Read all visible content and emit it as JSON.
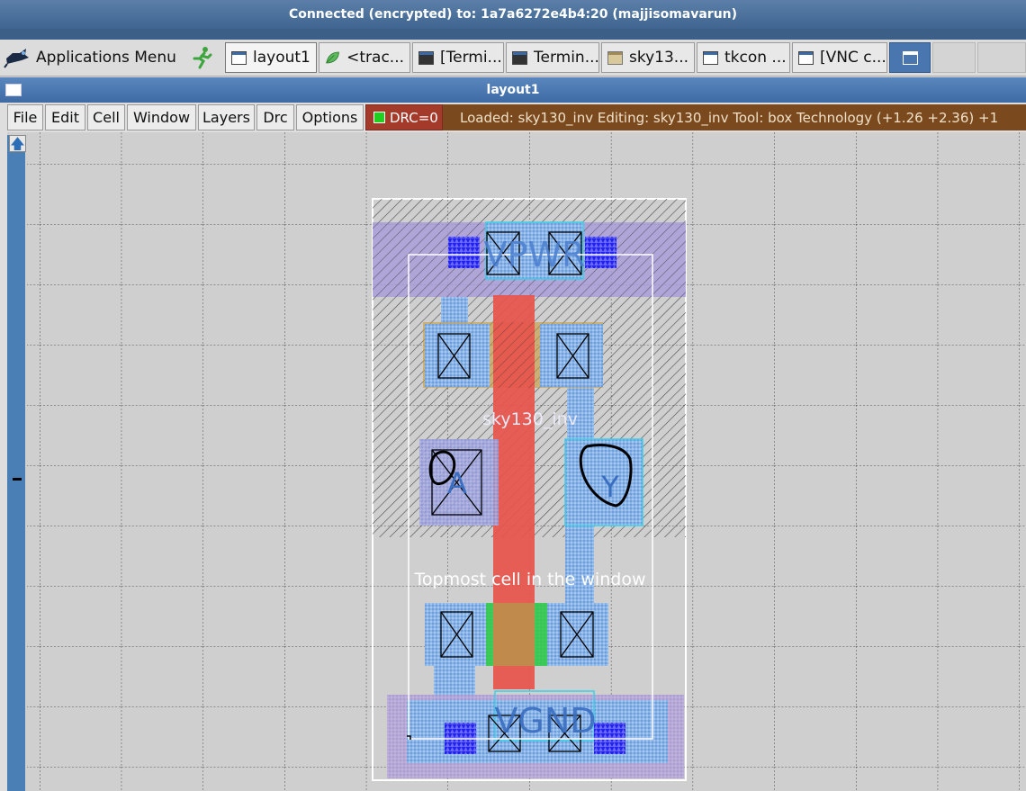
{
  "vnc": {
    "title": "Connected (encrypted) to: 1a7a6272e4b4:20 (majjisomavarun)"
  },
  "taskbar": {
    "app_menu": "Applications Menu",
    "tasks": [
      {
        "label": "layout1"
      },
      {
        "label": "<trac..."
      },
      {
        "label": "[Termi..."
      },
      {
        "label": "Termin..."
      },
      {
        "label": "sky13..."
      },
      {
        "label": "tkcon ..."
      },
      {
        "label": "[VNC c..."
      }
    ]
  },
  "window": {
    "title": "layout1"
  },
  "menu": {
    "items": [
      "File",
      "Edit",
      "Cell",
      "Window",
      "Layers",
      "Drc",
      "Options"
    ],
    "drc_label": "DRC=0",
    "status": "Loaded: sky130_inv Editing: sky130_inv Tool: box  Technology    (+1.26 +2.36) +1"
  },
  "layout": {
    "cell_name": "sky130_inv",
    "topmost_label": "Topmost cell in the window",
    "vpwr_label": "VPWR",
    "vgnd_label": "VGND",
    "pin_a": "A",
    "pin_y": "Y",
    "colors": {
      "background": "#cfcfcf",
      "grid": "#444444",
      "nwell": "#9a9ae6",
      "poly": "#e8544c",
      "diffusion": "#6fa8dc",
      "metal1": "#7eb6e8",
      "contact": "#1a1aff",
      "pdiff_green": "#2ecc40"
    }
  }
}
